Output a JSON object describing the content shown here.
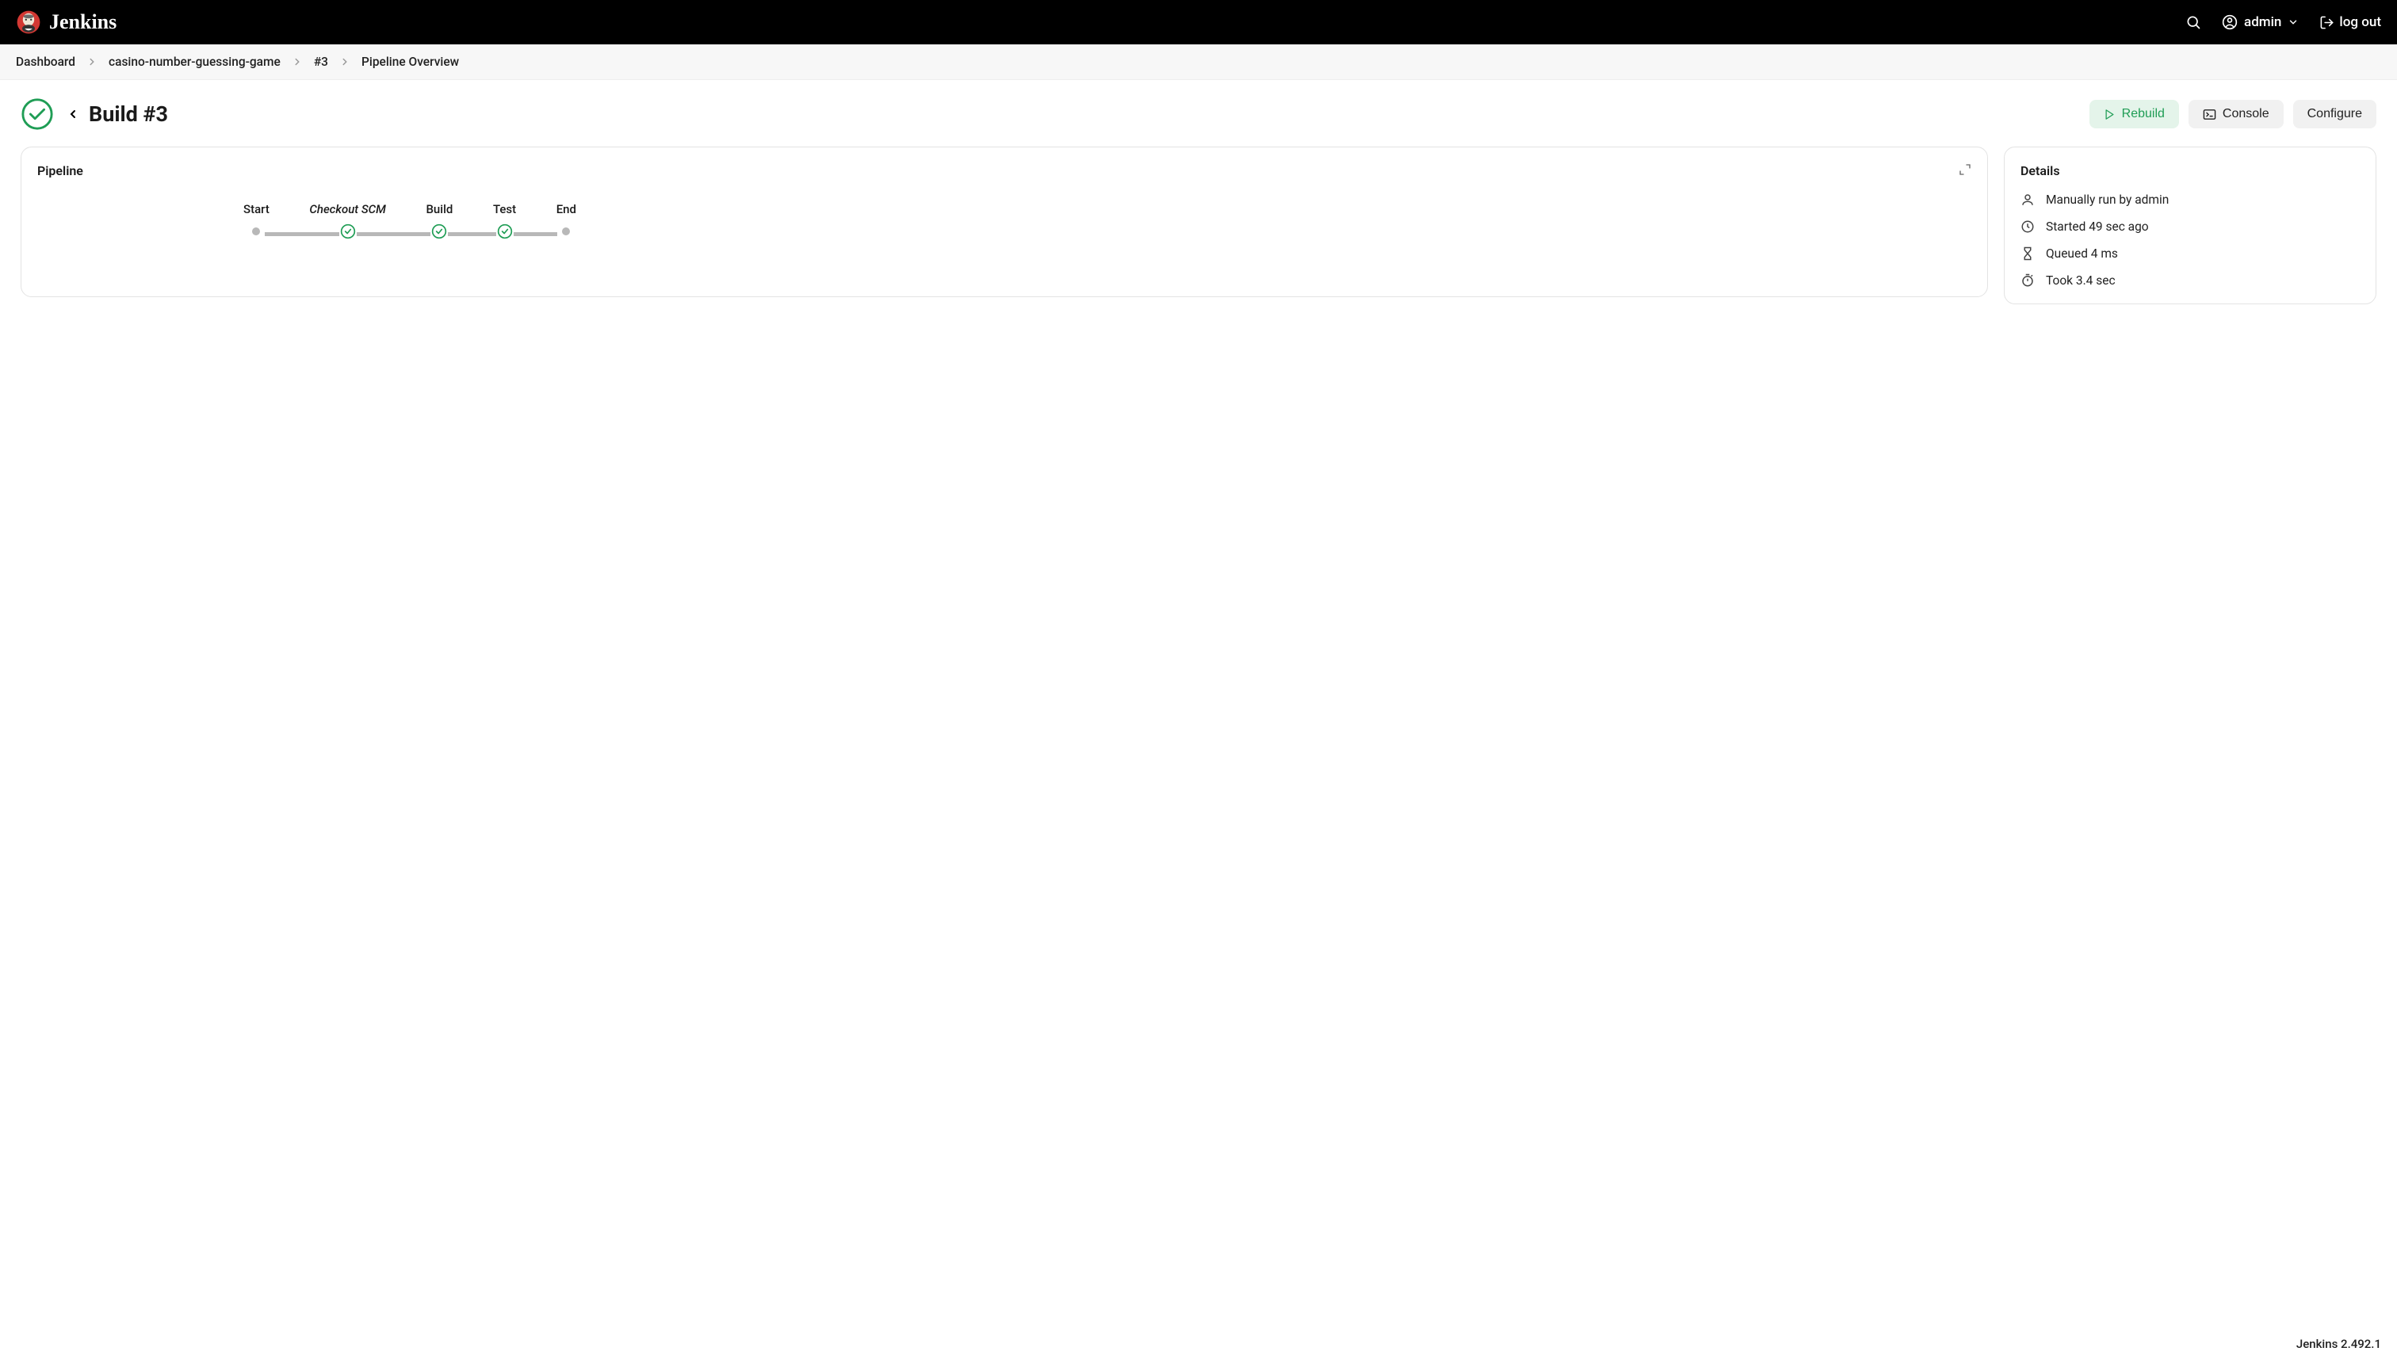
{
  "header": {
    "app_name": "Jenkins",
    "user": "admin",
    "logout": "log out"
  },
  "breadcrumb": {
    "items": [
      "Dashboard",
      "casino-number-guessing-game",
      "#3",
      "Pipeline Overview"
    ]
  },
  "title": {
    "heading": "Build #3"
  },
  "actions": {
    "rebuild": "Rebuild",
    "console": "Console",
    "configure": "Configure"
  },
  "pipeline": {
    "card_title": "Pipeline",
    "stages": [
      {
        "label": "Start",
        "status": "dot",
        "italic": false
      },
      {
        "label": "Checkout SCM",
        "status": "success",
        "italic": true
      },
      {
        "label": "Build",
        "status": "success",
        "italic": false
      },
      {
        "label": "Test",
        "status": "success",
        "italic": false
      },
      {
        "label": "End",
        "status": "dot",
        "italic": false
      }
    ]
  },
  "details": {
    "card_title": "Details",
    "rows": [
      {
        "icon": "user",
        "text": "Manually run by admin"
      },
      {
        "icon": "clock",
        "text": "Started 49 sec ago"
      },
      {
        "icon": "hourglass",
        "text": "Queued 4 ms"
      },
      {
        "icon": "stopwatch",
        "text": "Took 3.4 sec"
      }
    ]
  },
  "footer": {
    "version": "Jenkins 2.492.1"
  }
}
